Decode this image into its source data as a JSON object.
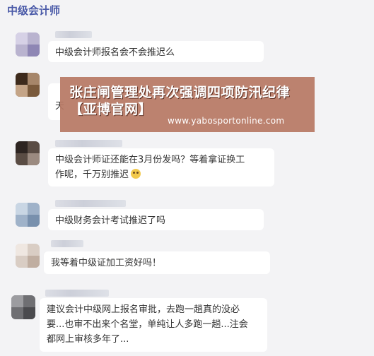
{
  "section": {
    "title": "中级会计师"
  },
  "messages": [
    {
      "text": "中级会计师报名会不会推迟么"
    },
    {
      "text": "天"
    },
    {
      "text_line1": "中级会计师证还能在3月份发吗？等着拿证换工",
      "text_line2": "作呢，千万别推迟"
    },
    {
      "text": "中级财务会计考试推迟了吗"
    },
    {
      "text": "我等着中级证加工资好吗！"
    },
    {
      "text_line1": "建议会计中级网上报名审批，去跑一趟真的没必",
      "text_line2": "要...也审不出来个名堂，单纯让人多跑一趟...注会",
      "text_line3": "都网上审核多年了..."
    }
  ],
  "overlay": {
    "headline": "张庄闸管理处再次强调四项防汛纪律【亚博官网】",
    "url": "www.yabosportonline.com"
  },
  "colors": {
    "title": "#4a5aa8",
    "overlay": "#b77864",
    "bubble": "#ffffff",
    "background": "#f3f3f5"
  }
}
